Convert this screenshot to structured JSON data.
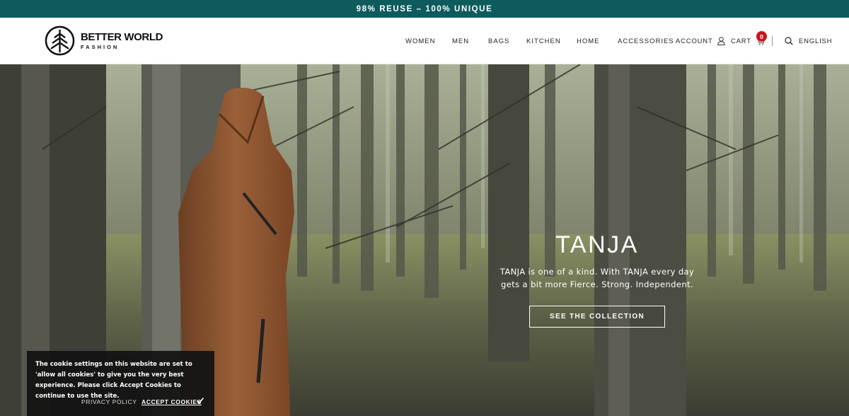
{
  "topbar": {
    "text": "98% REUSE – 100% UNIQUE"
  },
  "logo": {
    "line1": "BETTER WORLD",
    "line2": "FASHION"
  },
  "nav": {
    "items": [
      {
        "label": "WOMEN"
      },
      {
        "label": "MEN"
      },
      {
        "label": "BAGS"
      },
      {
        "label": "KITCHEN"
      },
      {
        "label": "HOME"
      },
      {
        "label": "ACCESSORIES"
      }
    ]
  },
  "header": {
    "account_label": "ACCOUNT",
    "cart_label": "CART",
    "cart_count": "0",
    "language_label": "ENGLISH",
    "icons": {
      "account": "user-icon",
      "cart": "cart-icon",
      "search": "search-icon"
    }
  },
  "hero": {
    "title": "TANJA",
    "text": "TANJA is one of a kind. With TANJA every day gets a bit more Fierce. Strong. Independent.",
    "cta": "SEE THE COLLECTION"
  },
  "cookie": {
    "text": "The cookie settings on this website are set to 'allow all cookies' to give you the very best experience. Please click Accept Cookies to continue to use the site.",
    "privacy": "PRIVACY POLICY",
    "accept": "ACCEPT COOKIES"
  },
  "colors": {
    "topbar": "#0d5b5d",
    "badge": "#c6161c"
  }
}
